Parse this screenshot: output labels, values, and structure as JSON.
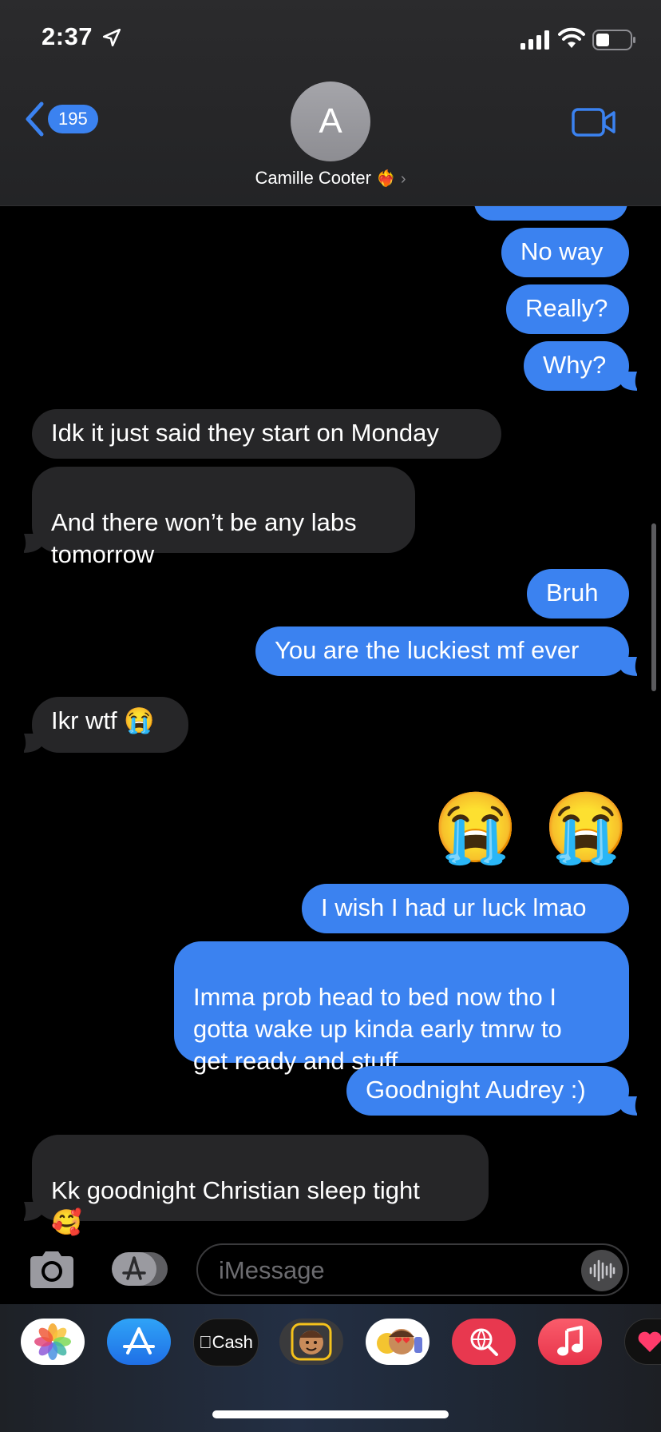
{
  "status": {
    "time": "2:37"
  },
  "header": {
    "back_count": "195",
    "avatar_initial": "A",
    "contact_name": "Camille Cooter",
    "contact_emoji": "❤️‍🔥",
    "chevron": "›"
  },
  "messages": [
    {
      "from": "me",
      "text": "No way"
    },
    {
      "from": "me",
      "text": "Really?"
    },
    {
      "from": "me",
      "text": "Why?"
    },
    {
      "from": "them",
      "text": "Idk it just said they start on Monday"
    },
    {
      "from": "them",
      "text": "And there won’t be any labs\ntomorrow"
    },
    {
      "from": "me",
      "text": "Bruh"
    },
    {
      "from": "me",
      "text": "You are the luckiest mf ever"
    },
    {
      "from": "them",
      "text": "Ikr wtf 😭"
    },
    {
      "from": "me",
      "text": "😭 😭"
    },
    {
      "from": "me",
      "text": "I wish I had ur luck lmao"
    },
    {
      "from": "me",
      "text": "Imma prob head to bed now tho I\ngotta wake up kinda early tmrw to\nget ready and stuff"
    },
    {
      "from": "me",
      "text": "Goodnight Audrey :)"
    },
    {
      "from": "them",
      "text": "Kk goodnight Christian sleep tight\n🥰"
    }
  ],
  "compose": {
    "placeholder": "iMessage"
  },
  "drawer": {
    "apps": [
      {
        "name": "photos-app-icon",
        "label": ""
      },
      {
        "name": "app-store-app-icon",
        "label": ""
      },
      {
        "name": "apple-cash-app-icon",
        "label": "Cash"
      },
      {
        "name": "memoji-stickers-app-icon",
        "label": ""
      },
      {
        "name": "animoji-app-icon",
        "label": ""
      },
      {
        "name": "web-images-app-icon",
        "label": ""
      },
      {
        "name": "music-app-icon",
        "label": ""
      },
      {
        "name": "digital-touch-app-icon",
        "label": ""
      }
    ]
  },
  "colors": {
    "sent_bubble": "#3b82f0",
    "received_bubble": "#262628",
    "accent": "#3b82f0"
  }
}
